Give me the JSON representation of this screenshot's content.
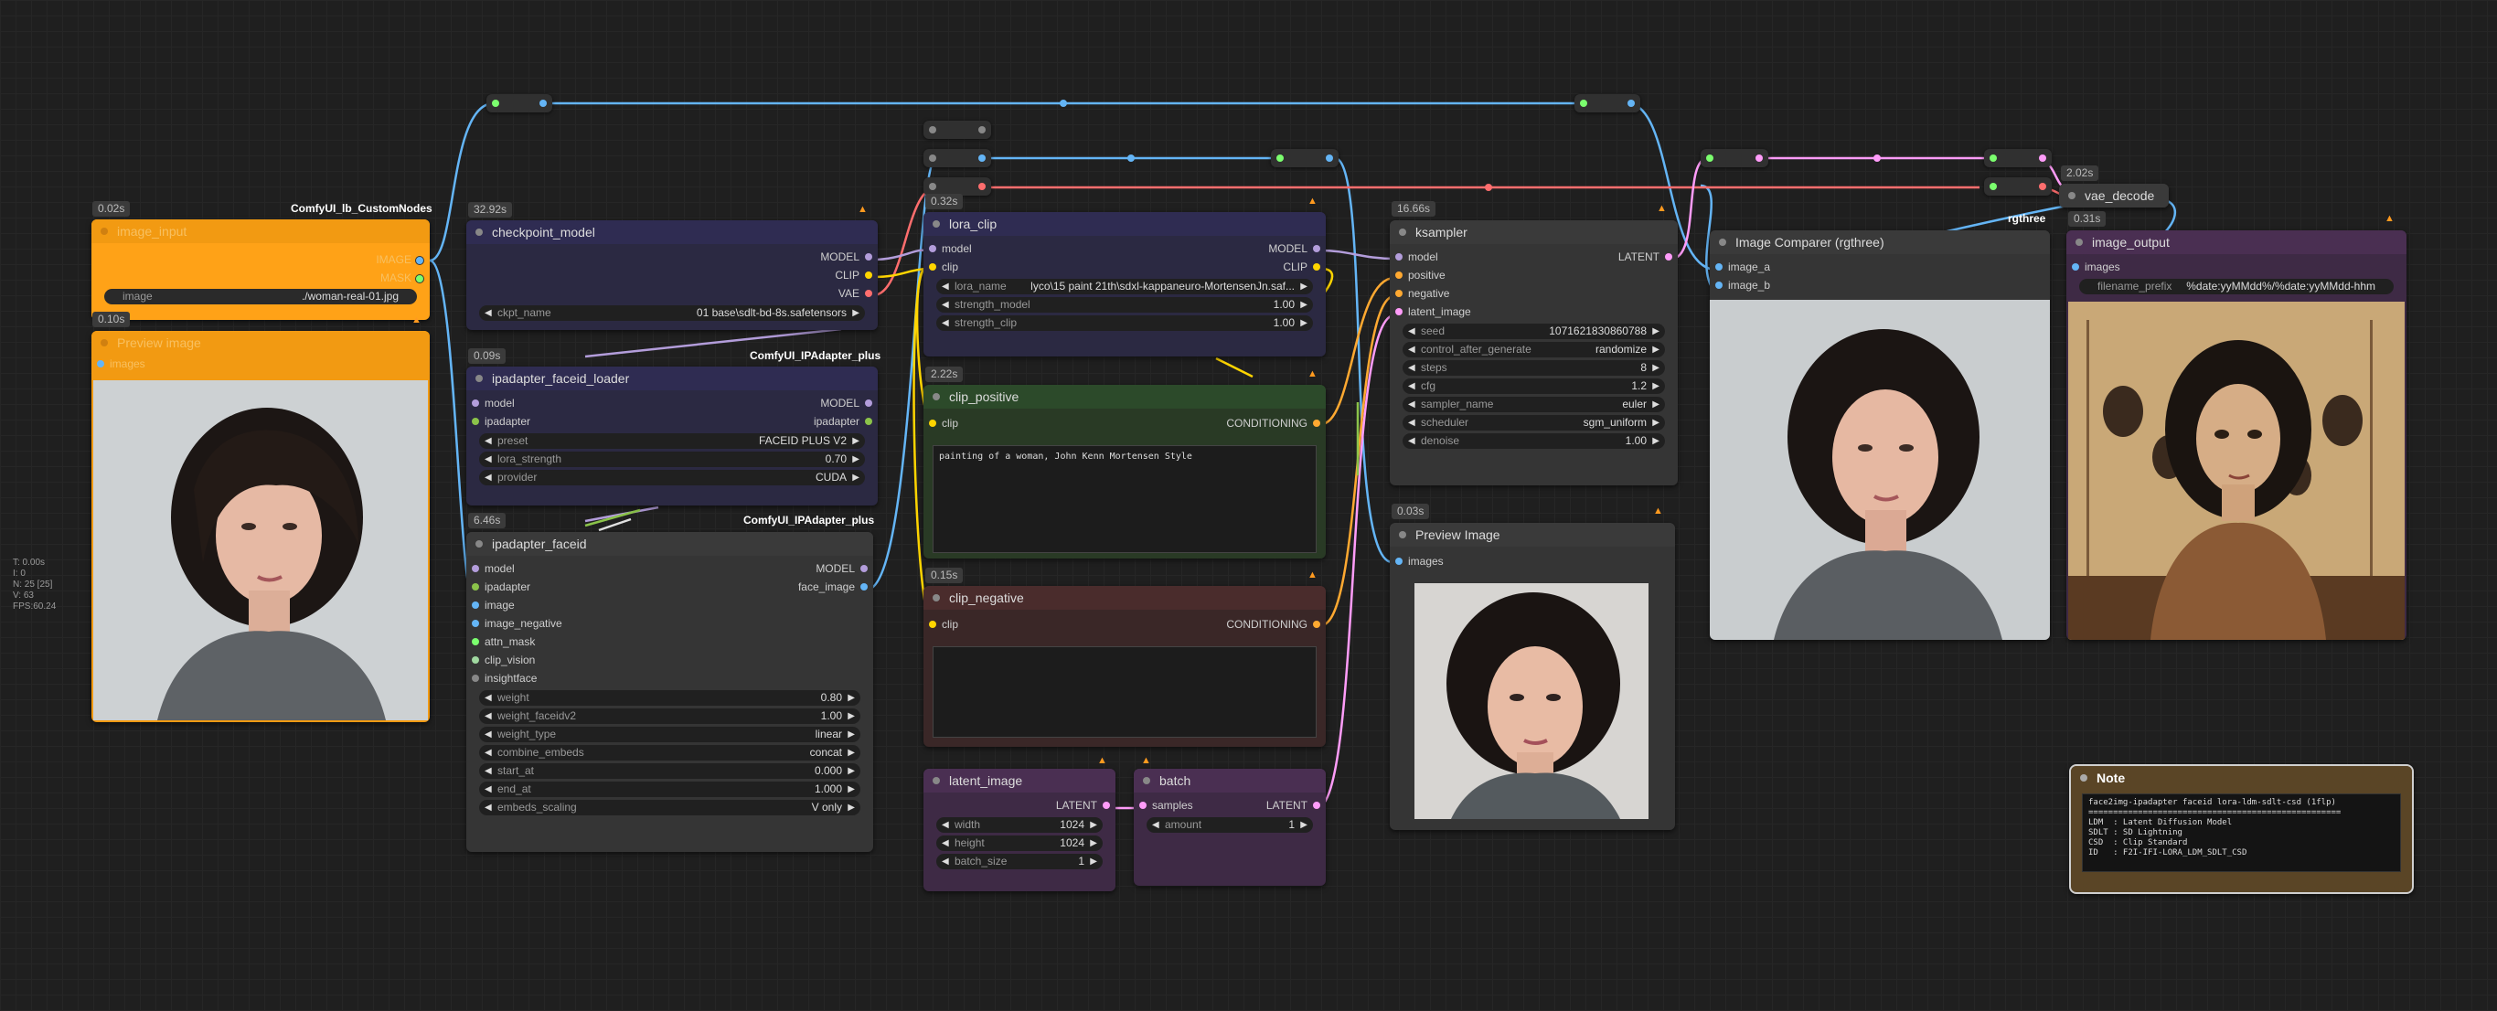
{
  "colors": {
    "model": "#b39ddb",
    "clip": "#ffd500",
    "vae": "#ff6e6e",
    "image": "#64b5f6",
    "latent": "#ff9cf9",
    "conditioning": "#ffa931",
    "ipadapter": "#8bc34a",
    "generic": "#9e9e9e"
  },
  "hud": {
    "lines": [
      "T: 0.00s",
      "I: 0",
      "N: 25 [25]",
      "V: 63",
      "FPS:60.24"
    ]
  },
  "image_input": {
    "time": "0.02s",
    "pack": "ComfyUI_lb_CustomNodes",
    "title": "image_input",
    "outputs": [
      "IMAGE",
      "MASK"
    ],
    "widget": {
      "label": "image",
      "value": "./woman-real-01.jpg"
    }
  },
  "preview_left": {
    "time": "0.10s",
    "title": "Preview image",
    "input": "images"
  },
  "checkpoint": {
    "time": "32.92s",
    "title": "checkpoint_model",
    "outputs": [
      "MODEL",
      "CLIP",
      "VAE"
    ],
    "widget": {
      "label": "ckpt_name",
      "value": "01 base\\sdlt-bd-8s.safetensors"
    }
  },
  "faceid_loader": {
    "time": "0.09s",
    "pack": "ComfyUI_IPAdapter_plus",
    "title": "ipadapter_faceid_loader",
    "inputs": [
      "model"
    ],
    "outputs": [
      "MODEL"
    ],
    "inputs2": [
      "ipadapter"
    ],
    "outputs2": [
      "ipadapter"
    ],
    "widgets": [
      {
        "label": "preset",
        "value": "FACEID PLUS V2"
      },
      {
        "label": "lora_strength",
        "value": "0.70"
      },
      {
        "label": "provider",
        "value": "CUDA"
      }
    ]
  },
  "faceid": {
    "time": "6.46s",
    "pack": "ComfyUI_IPAdapter_plus",
    "title": "ipadapter_faceid",
    "inputs": [
      "model",
      "ipadapter",
      "image",
      "image_negative",
      "attn_mask",
      "clip_vision",
      "insightface"
    ],
    "outputs": [
      "MODEL",
      "face_image"
    ],
    "widgets": [
      {
        "label": "weight",
        "value": "0.80"
      },
      {
        "label": "weight_faceidv2",
        "value": "1.00"
      },
      {
        "label": "weight_type",
        "value": "linear"
      },
      {
        "label": "combine_embeds",
        "value": "concat"
      },
      {
        "label": "start_at",
        "value": "0.000"
      },
      {
        "label": "end_at",
        "value": "1.000"
      },
      {
        "label": "embeds_scaling",
        "value": "V only"
      }
    ]
  },
  "lora_clip": {
    "time": "0.32s",
    "title": "lora_clip",
    "inputs": [
      "model",
      "clip"
    ],
    "outputs": [
      "MODEL",
      "CLIP"
    ],
    "widgets": [
      {
        "label": "lora_name",
        "value": "lyco\\15 paint 21th\\sdxl-kappaneuro-MortensenJn.saf..."
      },
      {
        "label": "strength_model",
        "value": "1.00"
      },
      {
        "label": "strength_clip",
        "value": "1.00"
      }
    ]
  },
  "clip_positive": {
    "time": "2.22s",
    "title": "clip_positive",
    "input": "clip",
    "output": "CONDITIONING",
    "text": "painting of a woman, John Kenn Mortensen Style"
  },
  "clip_negative": {
    "time": "0.15s",
    "title": "clip_negative",
    "input": "clip",
    "output": "CONDITIONING",
    "text": ""
  },
  "latent_image": {
    "title": "latent_image",
    "output": "LATENT",
    "widgets": [
      {
        "label": "width",
        "value": "1024"
      },
      {
        "label": "height",
        "value": "1024"
      },
      {
        "label": "batch_size",
        "value": "1"
      }
    ]
  },
  "batch": {
    "title": "batch",
    "input": "samples",
    "output": "LATENT",
    "widget": {
      "label": "amount",
      "value": "1"
    }
  },
  "ksampler": {
    "time": "16.66s",
    "title": "ksampler",
    "inputs": [
      "model",
      "positive",
      "negative",
      "latent_image"
    ],
    "output": "LATENT",
    "widgets": [
      {
        "label": "seed",
        "value": "1071621830860788"
      },
      {
        "label": "control_after_generate",
        "value": "randomize"
      },
      {
        "label": "steps",
        "value": "8"
      },
      {
        "label": "cfg",
        "value": "1.2"
      },
      {
        "label": "sampler_name",
        "value": "euler"
      },
      {
        "label": "scheduler",
        "value": "sgm_uniform"
      },
      {
        "label": "denoise",
        "value": "1.00"
      }
    ]
  },
  "preview_mid": {
    "time": "0.03s",
    "title": "Preview Image",
    "input": "images"
  },
  "comparer": {
    "pack": "rgthree",
    "title": "Image Comparer (rgthree)",
    "inputs": [
      "image_a",
      "image_b"
    ]
  },
  "vae_decode": {
    "time": "2.02s",
    "title": "vae_decode"
  },
  "image_output": {
    "time": "0.31s",
    "title": "image_output",
    "input": "images",
    "widget": {
      "label": "filename_prefix",
      "value": "%date:yyMMdd%/%date:yyMMdd-hhm"
    }
  },
  "note": {
    "title": "Note",
    "text": "face2img-ipadapter faceid lora-ldm-sdlt-csd (1flp)\n===================================================\nLDM  : Latent Diffusion Model\nSDLT : SD Lightning\nCSD  : Clip Standard\nID   : F2I-IFI-LORA_LDM_SDLT_CSD"
  }
}
